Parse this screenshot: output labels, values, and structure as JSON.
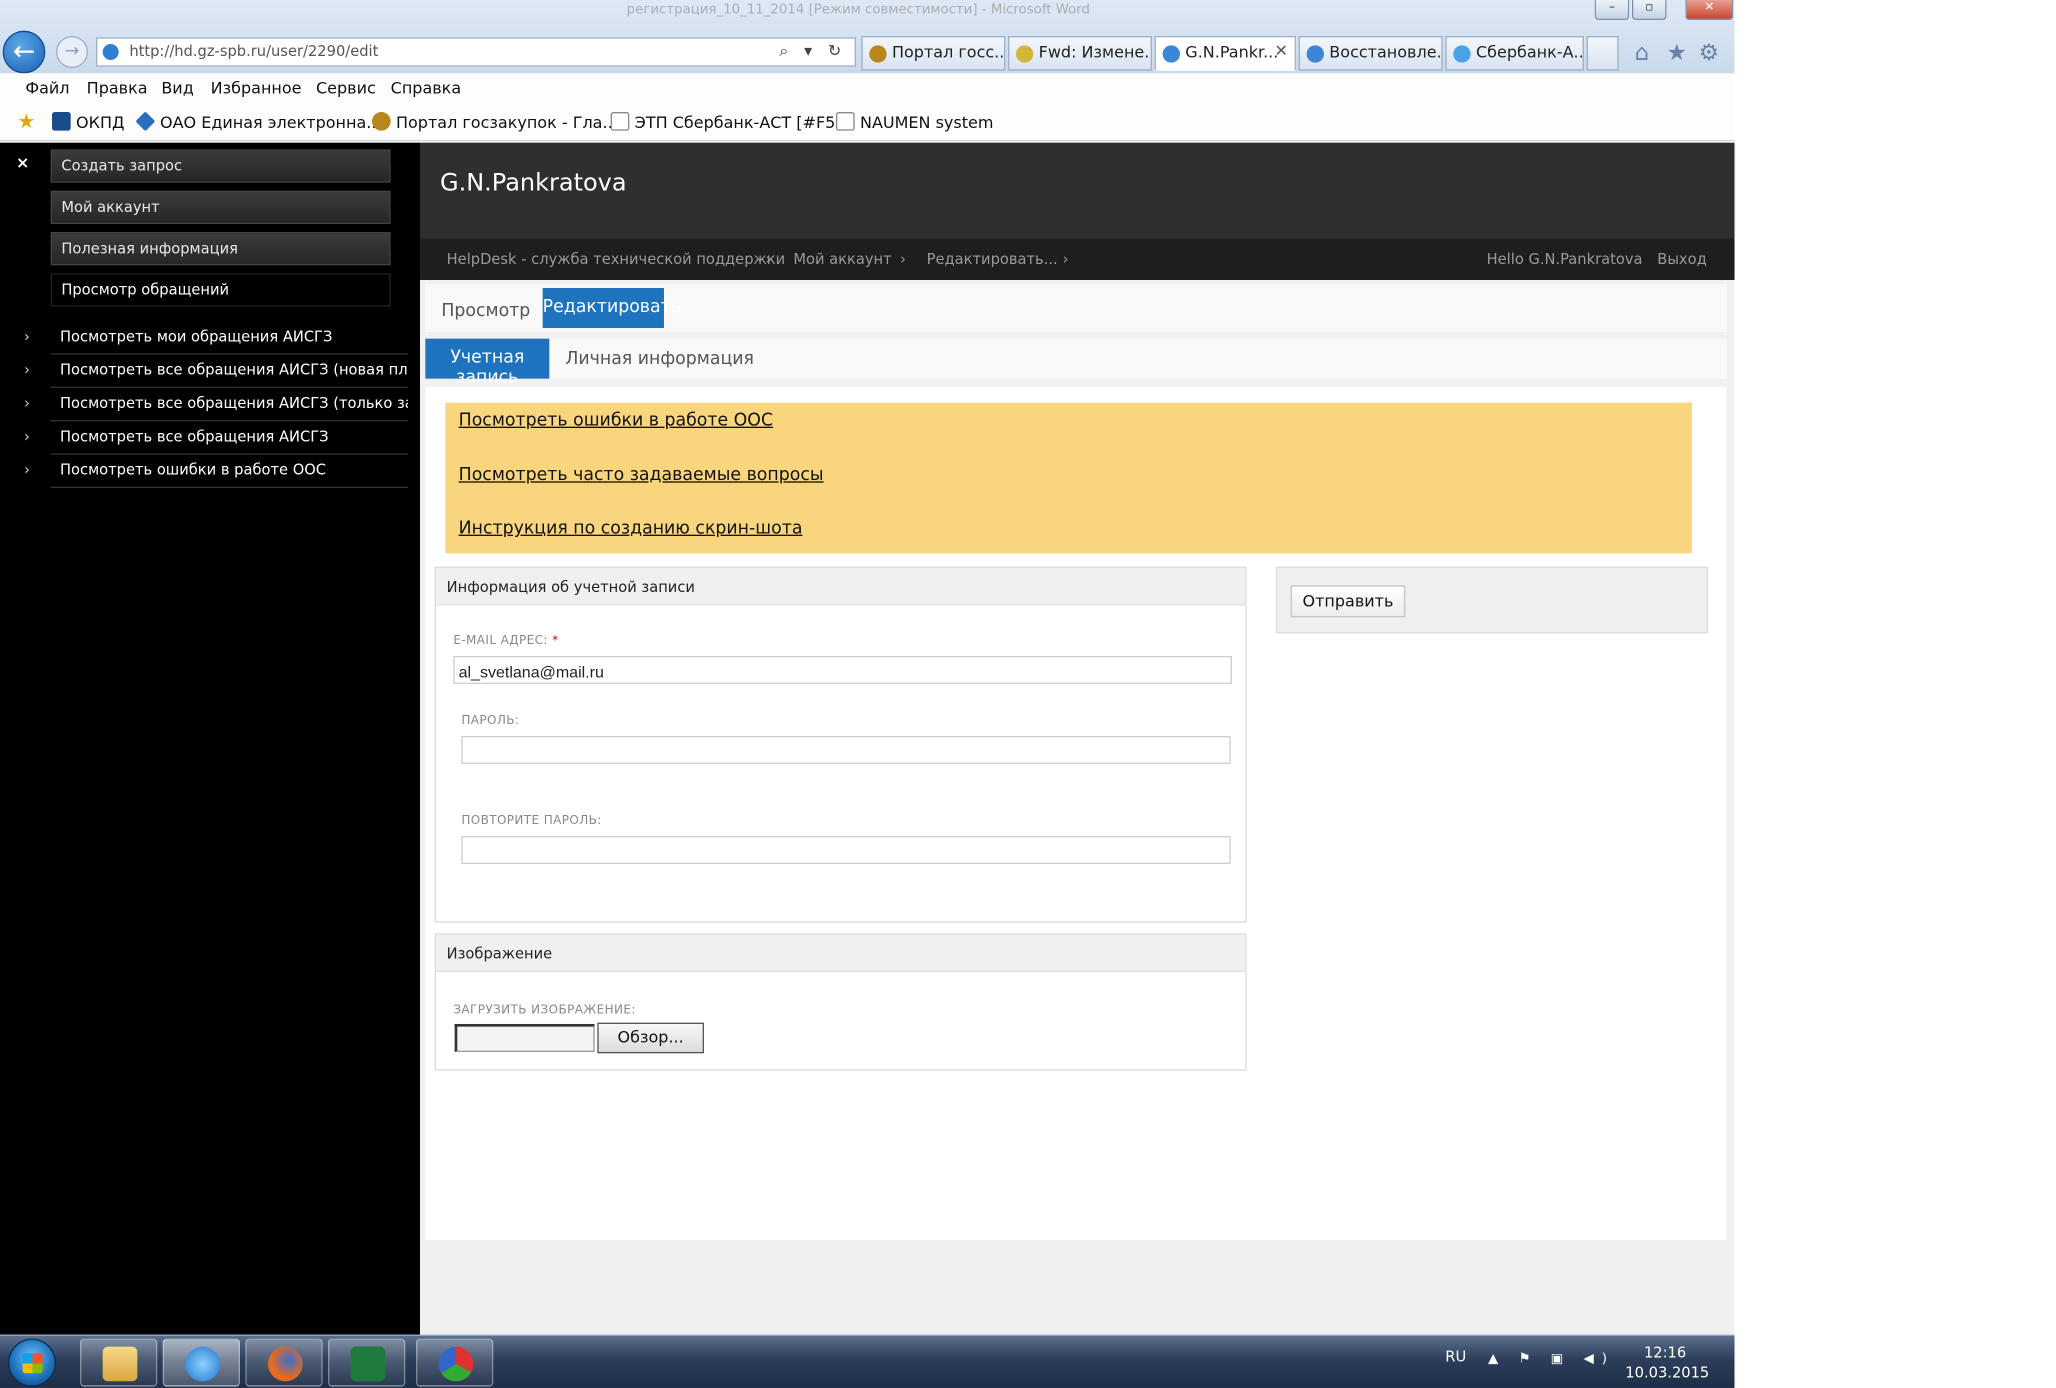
{
  "window": {
    "title": "регистрация_10_11_2014 [Режим совместимости] - Microsoft Word",
    "controls": {
      "minimize": "–",
      "maximize": "▫",
      "close": "✕"
    }
  },
  "browser": {
    "url": "http://hd.gz-spb.ru/user/2290/edit",
    "address_tools": "⌕ ▾ ↻",
    "tabs": [
      {
        "label": "Портал госс..."
      },
      {
        "label": "Fwd: Измене..."
      },
      {
        "label": "G.N.Pankr...",
        "active": true
      },
      {
        "label": "Восстановле..."
      },
      {
        "label": "Сбербанк-А..."
      }
    ],
    "tab_close": "✕",
    "right_icons": {
      "home": "⌂",
      "favorites": "★",
      "settings": "⚙"
    },
    "menu": [
      "Файл",
      "Правка",
      "Вид",
      "Избранное",
      "Сервис",
      "Справка"
    ],
    "favorites": [
      {
        "label": "ОКПД",
        "icon": "k-icon",
        "color": "#1a4b8c"
      },
      {
        "label": "ОАО Единая электронна...",
        "icon": "diamond-icon",
        "color": "#2a6fbf"
      },
      {
        "label": "Портал госзакупок - Гла...",
        "icon": "emblem-icon",
        "color": "#b8861b"
      },
      {
        "label": "ЭТП Сбербанк-АСТ [#F5]",
        "icon": "page-icon",
        "color": "#888888"
      },
      {
        "label": "NAUMEN system",
        "icon": "page-icon",
        "color": "#888888"
      }
    ]
  },
  "sidebar": {
    "close": "×",
    "buttons": [
      {
        "label": "Создать запрос"
      },
      {
        "label": "Мой аккаунт"
      },
      {
        "label": "Полезная информация"
      },
      {
        "label": "Просмотр обращений",
        "active": true
      }
    ],
    "chevron": "›",
    "links": [
      {
        "label": "Посмотреть мои обращения АИСГЗ"
      },
      {
        "label": "Посмотреть все обращения АИСГЗ (новая платфор"
      },
      {
        "label": "Посмотреть все обращения АИСГЗ (только закрыт"
      },
      {
        "label": "Посмотреть все обращения АИСГЗ"
      },
      {
        "label": "Посмотреть ошибки в работе ООС"
      }
    ]
  },
  "header": {
    "site_title": "G.N.Pankratova",
    "breadcrumbs": [
      "HelpDesk - служба технической поддержки",
      "Мой аккаунт",
      "Редактировать..."
    ],
    "separator": "›",
    "greeting": "Hello G.N.Pankratova",
    "logout": "Выход"
  },
  "tabs_primary": {
    "view": "Просмотр",
    "edit": "Редактировать"
  },
  "tabs_secondary": {
    "account": "Учетная запись",
    "personal": "Личная информация"
  },
  "notice": {
    "links": [
      "Посмотреть ошибки в работе ООС",
      "Посмотреть часто задаваемые вопросы",
      "Инструкция по созданию скрин-шота"
    ]
  },
  "account_box": {
    "title": "Информация об учетной записи",
    "email_label": "E-mail адрес:",
    "required_mark": "*",
    "email_value": "al_svetlana@mail.ru",
    "password_label": "Пароль:",
    "confirm_label": "Повторите пароль:"
  },
  "image_box": {
    "title": "Изображение",
    "upload_label": "Загрузить изображение:",
    "browse_button": "Обзор..."
  },
  "actions": {
    "submit": "Отправить"
  },
  "taskbar": {
    "language": "RU",
    "time": "12:16",
    "date": "10.03.2015",
    "tray_icons": "▲ ⚑ ▣ ◀)"
  }
}
